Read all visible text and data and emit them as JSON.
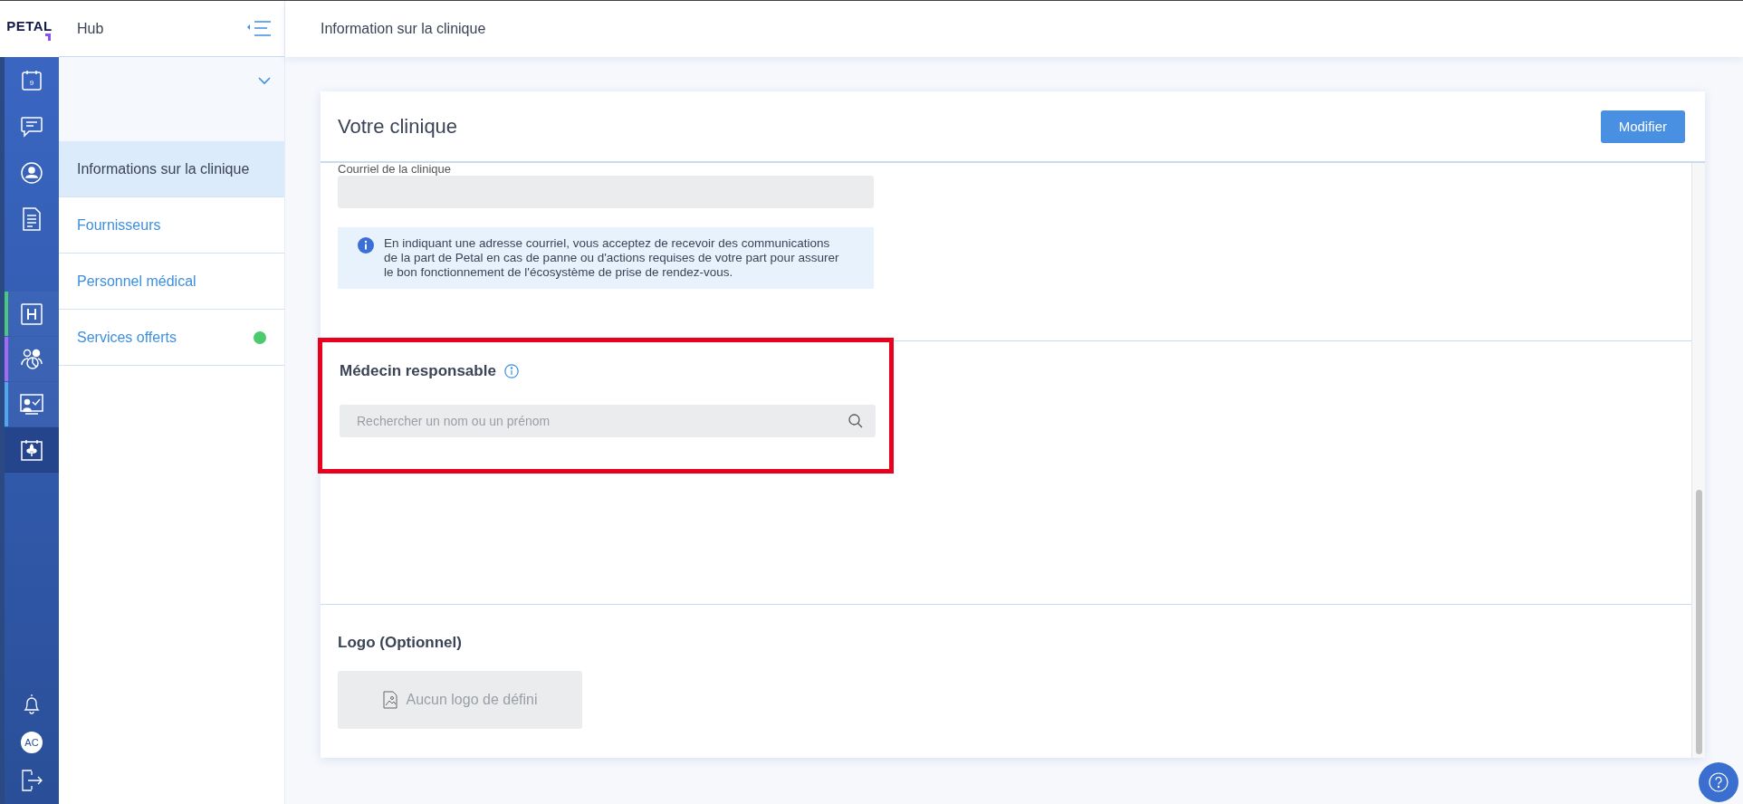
{
  "brand": {
    "logo": "PETAL"
  },
  "hub": {
    "title": "Hub"
  },
  "rail": {
    "top": [
      {
        "kind": "calendar",
        "badge": "9",
        "selected": false
      },
      {
        "kind": "chat",
        "selected": false
      },
      {
        "kind": "user",
        "selected": false
      },
      {
        "kind": "document",
        "selected": false
      }
    ],
    "modules": [
      {
        "kind": "hospital",
        "selected": false,
        "color": "#4cc57f"
      },
      {
        "kind": "people",
        "selected": false,
        "color": "#a26af5"
      },
      {
        "kind": "presentation",
        "selected": false,
        "color": "#52a6ef"
      },
      {
        "kind": "fleur",
        "selected": true
      }
    ],
    "avatar": "AC"
  },
  "nav": {
    "items": [
      {
        "label": "Informations sur la clinique",
        "selected": true,
        "flagged": false
      },
      {
        "label": "Fournisseurs",
        "selected": false,
        "flagged": false
      },
      {
        "label": "Personnel médical",
        "selected": false,
        "flagged": false
      },
      {
        "label": "Services offerts",
        "selected": false,
        "flagged": true
      }
    ]
  },
  "page_title": "Information sur la clinique",
  "card": {
    "title": "Votre clinique",
    "edit_button": "Modifier",
    "email": {
      "label": "Courriel de la clinique"
    },
    "notice": "En indiquant une adresse courriel, vous acceptez de recevoir des communications de la part de Petal en cas de panne ou d'actions requises de votre part pour assurer le bon fonctionnement de l'écosystème de prise de rendez-vous.",
    "doctor": {
      "title": "Médecin responsable",
      "placeholder": "Rechercher un nom ou un prénom",
      "highlighted": true
    },
    "logo": {
      "title": "Logo (Optionnel)",
      "empty": "Aucun logo de défini"
    }
  }
}
